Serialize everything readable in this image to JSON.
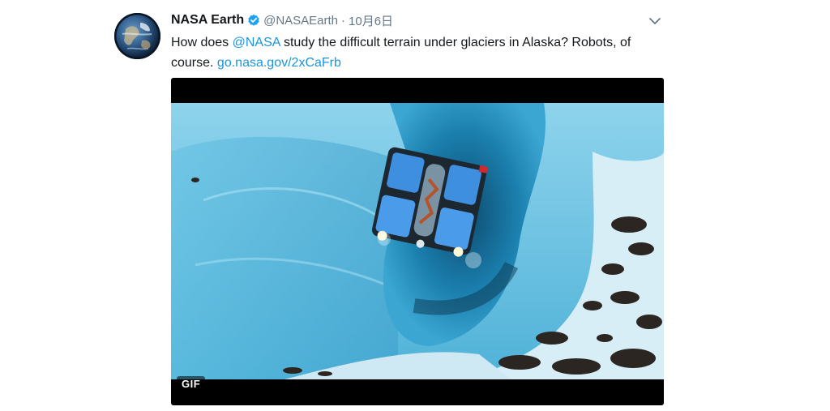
{
  "tweet": {
    "display_name": "NASA Earth",
    "handle": "@NASAEarth",
    "separator": "·",
    "date": "10月6日",
    "text_part1": "How does ",
    "mention": "@NASA",
    "text_part2": " study the difficult terrain under glaciers in Alaska? Robots, of course. ",
    "link": "go.nasa.gov/2xCaFrb"
  },
  "media": {
    "badge": "GIF"
  },
  "icons": {
    "avatar": "earth-globe-avatar",
    "verified": "verified-badge-icon",
    "menu": "chevron-down-icon"
  },
  "colors": {
    "link": "#1b95e0",
    "verified": "#1da1f2",
    "name": "#14171a",
    "muted": "#657786"
  }
}
